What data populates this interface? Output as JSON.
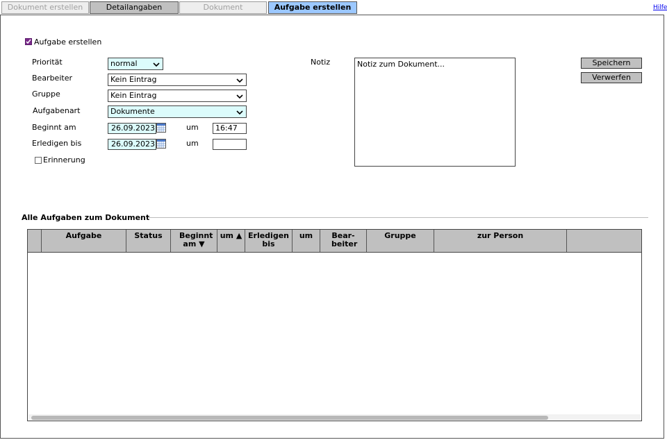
{
  "tabs": [
    {
      "label": "Dokument erstellen"
    },
    {
      "label": "Detailangaben"
    },
    {
      "label": "Dokument"
    },
    {
      "label": "Aufgabe erstellen"
    }
  ],
  "help_label": "Hilfe",
  "form": {
    "create_task_label": "Aufgabe erstellen",
    "create_task_checked": true,
    "priority_label": "Priorität",
    "priority_value": "normal",
    "assignee_label": "Bearbeiter",
    "assignee_value": "Kein Eintrag",
    "group_label": "Gruppe",
    "group_value": "Kein Eintrag",
    "tasktype_label": "Aufgabenart",
    "tasktype_value": "Dokumente",
    "start_label": "Beginnt am",
    "start_date": "26.09.2023",
    "start_um_label": "um",
    "start_time": "16:47",
    "due_label": "Erledigen bis",
    "due_date": "26.09.2023",
    "due_um_label": "um",
    "due_time": "",
    "reminder_label": "Erinnerung",
    "reminder_checked": false,
    "note_label": "Notiz",
    "note_value": "Notiz zum Dokument...",
    "save_label": "Speichern",
    "discard_label": "Verwerfen"
  },
  "tasks_section": {
    "title": "Alle Aufgaben zum Dokument",
    "columns": [
      {
        "label": ""
      },
      {
        "label": "Aufgabe"
      },
      {
        "label": "Status"
      },
      {
        "label": "Beginnt am ▼"
      },
      {
        "label": "um ▲"
      },
      {
        "label": "Erledigen bis"
      },
      {
        "label": "um"
      },
      {
        "label": "Bear-beiter"
      },
      {
        "label": "Gruppe"
      },
      {
        "label": "zur Person"
      },
      {
        "label": ""
      }
    ],
    "rows": []
  },
  "colors": {
    "active_tab": "#9cc8ff",
    "checkbox_accent": "#7a2a8a",
    "highlight_field": "#dcfcfc",
    "button_bg": "#c0c0c0"
  }
}
